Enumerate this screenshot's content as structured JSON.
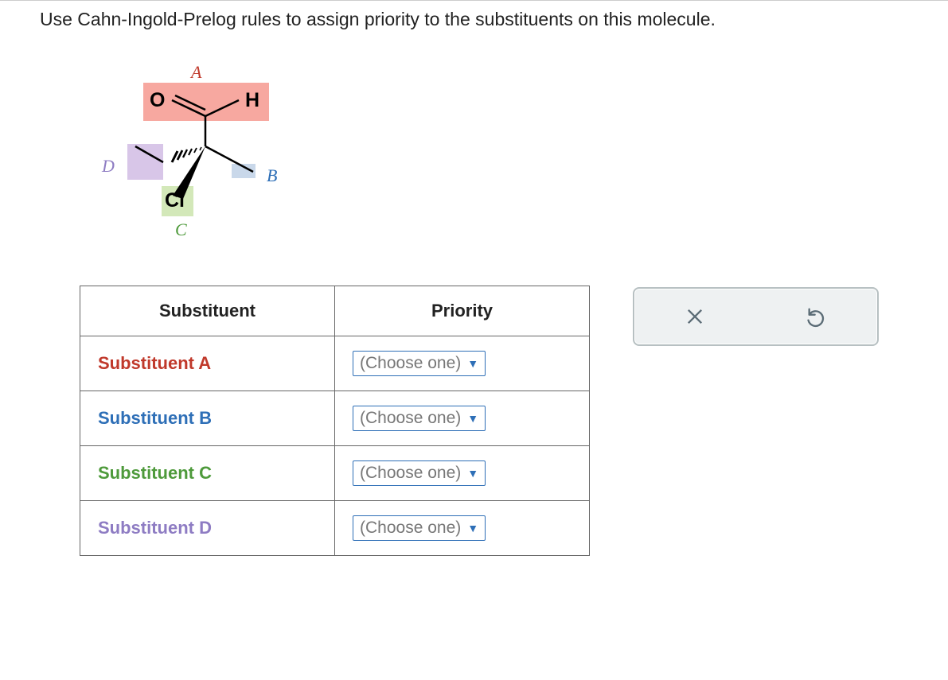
{
  "question": "Use Cahn-Ingold-Prelog rules to assign priority to the substituents on this molecule.",
  "molecule": {
    "atom_O": "O",
    "atom_H": "H",
    "atom_Cl": "Cl",
    "label_A": "A",
    "label_B": "B",
    "label_C": "C",
    "label_D": "D"
  },
  "table": {
    "header_substituent": "Substituent",
    "header_priority": "Priority",
    "rows": [
      {
        "label": "Substituent A",
        "dropdown": "(Choose one)"
      },
      {
        "label": "Substituent B",
        "dropdown": "(Choose one)"
      },
      {
        "label": "Substituent C",
        "dropdown": "(Choose one)"
      },
      {
        "label": "Substituent D",
        "dropdown": "(Choose one)"
      }
    ]
  },
  "icons": {
    "clear": "clear-icon",
    "reset": "reset-icon"
  }
}
